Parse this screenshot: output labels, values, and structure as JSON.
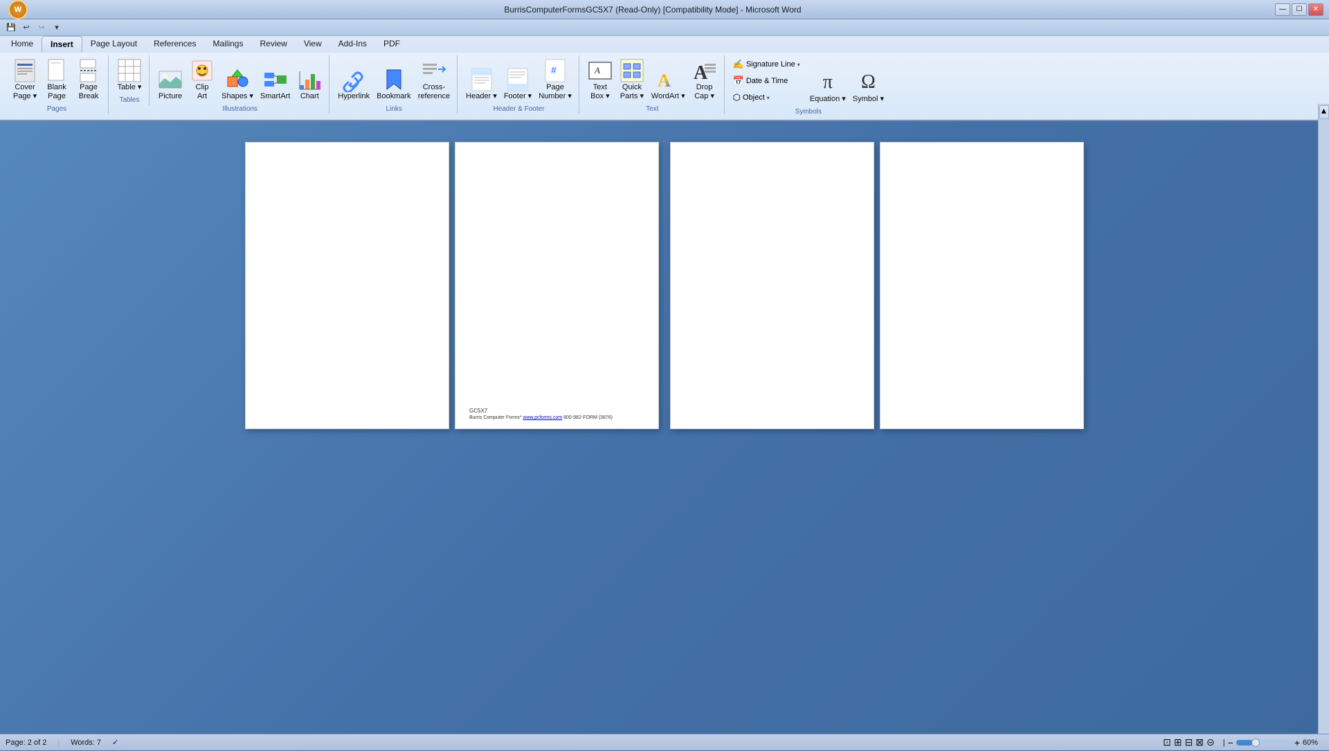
{
  "titleBar": {
    "title": "BurrisComputerFormsGC5X7 (Read-Only) [Compatibility Mode] - Microsoft Word",
    "controls": [
      "—",
      "☐",
      "✕"
    ]
  },
  "quickAccess": {
    "buttons": [
      "💾",
      "↩",
      "↪",
      "▾"
    ]
  },
  "ribbon": {
    "tabs": [
      "Home",
      "Insert",
      "Page Layout",
      "References",
      "Mailings",
      "Review",
      "View",
      "Add-Ins",
      "PDF"
    ],
    "activeTab": "Insert",
    "groups": [
      {
        "name": "Pages",
        "label": "Pages",
        "items": [
          {
            "id": "cover-page",
            "label": "Cover\nPage",
            "icon": "📄",
            "size": "large",
            "dropdown": true
          },
          {
            "id": "blank-page",
            "label": "Blank\nPage",
            "icon": "📃",
            "size": "large"
          },
          {
            "id": "page-break",
            "label": "Page\nBreak",
            "icon": "⊟",
            "size": "large"
          }
        ]
      },
      {
        "name": "Tables",
        "label": "Tables",
        "items": [
          {
            "id": "table",
            "label": "Table",
            "icon": "⊞",
            "size": "large",
            "dropdown": true
          }
        ]
      },
      {
        "name": "Illustrations",
        "label": "Illustrations",
        "items": [
          {
            "id": "picture",
            "label": "Picture",
            "icon": "🖼",
            "size": "large"
          },
          {
            "id": "clip-art",
            "label": "Clip\nArt",
            "icon": "🎨",
            "size": "large"
          },
          {
            "id": "shapes",
            "label": "Shapes",
            "icon": "◻",
            "size": "large",
            "dropdown": true
          },
          {
            "id": "smart-art",
            "label": "SmartArt",
            "icon": "📊",
            "size": "large"
          },
          {
            "id": "chart",
            "label": "Chart",
            "icon": "📈",
            "size": "large"
          }
        ]
      },
      {
        "name": "Links",
        "label": "Links",
        "items": [
          {
            "id": "hyperlink",
            "label": "Hyperlink",
            "icon": "🔗",
            "size": "large"
          },
          {
            "id": "bookmark",
            "label": "Bookmark",
            "icon": "🔖",
            "size": "large"
          },
          {
            "id": "cross-reference",
            "label": "Cross-\nreference",
            "icon": "↗",
            "size": "large"
          }
        ]
      },
      {
        "name": "Header & Footer",
        "label": "Header & Footer",
        "items": [
          {
            "id": "header",
            "label": "Header",
            "icon": "▤",
            "size": "large",
            "dropdown": true
          },
          {
            "id": "footer",
            "label": "Footer",
            "icon": "▥",
            "size": "large",
            "dropdown": true
          },
          {
            "id": "page-number",
            "label": "Page\nNumber",
            "icon": "#",
            "size": "large",
            "dropdown": true
          }
        ]
      },
      {
        "name": "Text",
        "label": "Text",
        "items": [
          {
            "id": "text-box",
            "label": "Text\nBox",
            "icon": "🗒",
            "size": "large",
            "dropdown": true
          },
          {
            "id": "quick-parts",
            "label": "Quick\nParts",
            "icon": "📦",
            "size": "large",
            "dropdown": true
          },
          {
            "id": "wordart",
            "label": "WordArt",
            "icon": "A",
            "size": "large",
            "dropdown": true
          },
          {
            "id": "drop-cap",
            "label": "Drop\nCap",
            "icon": "A",
            "size": "large",
            "dropdown": true
          }
        ]
      },
      {
        "name": "Symbols",
        "label": "Symbols",
        "items": [
          {
            "id": "signature-line",
            "label": "Signature Line",
            "icon": "✍",
            "small": true,
            "dropdown": true
          },
          {
            "id": "date-time",
            "label": "Date & Time",
            "icon": "📅",
            "small": true
          },
          {
            "id": "object",
            "label": "Object",
            "icon": "⬡",
            "small": true,
            "dropdown": true
          },
          {
            "id": "equation",
            "label": "Equation",
            "icon": "π",
            "size": "large",
            "dropdown": true
          },
          {
            "id": "symbol",
            "label": "Symbol",
            "icon": "Ω",
            "size": "large",
            "dropdown": true
          }
        ]
      }
    ]
  },
  "pages": [
    {
      "id": "page1",
      "content": "",
      "footer": null
    },
    {
      "id": "page2",
      "content": "",
      "footer": {
        "line1": "GC5X7",
        "line2": "Burris Computer Forms* www.pcforms.com 800-982-FORM (3876)"
      }
    },
    {
      "id": "page3",
      "content": "",
      "footer": null
    },
    {
      "id": "page4",
      "content": "",
      "footer": null
    }
  ],
  "statusBar": {
    "pageInfo": "Page: 2 of 2",
    "wordCount": "Words: 7",
    "checkmark": "✓",
    "viewIcons": [
      "⊡",
      "⊞",
      "⊟",
      "⊠",
      "⊝"
    ],
    "zoom": "60%",
    "zoomMinus": "−",
    "zoomPlus": "+"
  }
}
